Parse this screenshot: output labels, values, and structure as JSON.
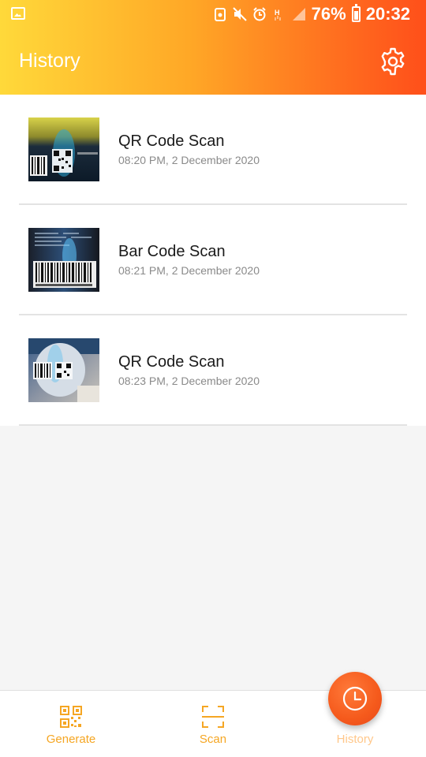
{
  "statusbar": {
    "battery": "76%",
    "time": "20:32"
  },
  "header": {
    "title": "History"
  },
  "items": [
    {
      "title": "QR Code Scan",
      "time": "08:20 PM, 2 December 2020",
      "thumb": "qr-photo"
    },
    {
      "title": "Bar Code Scan",
      "time": "08:21 PM, 2 December 2020",
      "thumb": "barcode-photo"
    },
    {
      "title": "QR Code Scan",
      "time": "08:23 PM, 2 December 2020",
      "thumb": "qr-barcode-photo"
    }
  ],
  "nav": {
    "generate": "Generate",
    "scan": "Scan",
    "history": "History"
  },
  "colors": {
    "accent": "#f5a623",
    "fab": "#f55a1c",
    "header_start": "#ffd93a",
    "header_end": "#ff4f1a"
  }
}
